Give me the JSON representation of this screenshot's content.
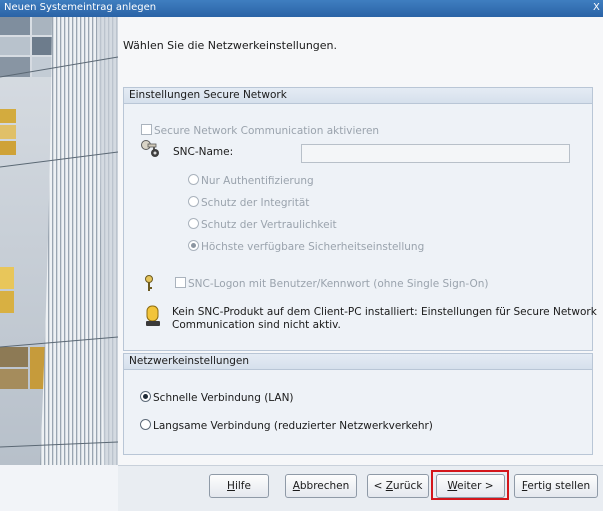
{
  "window": {
    "title": "Neuen Systemeintrag anlegen",
    "close_glyph": "X"
  },
  "intro_text": "Wählen Sie die Netzwerkeinstellungen.",
  "secure_network": {
    "heading": "Einstellungen Secure Network",
    "snc_activate_label": "Secure Network Communication aktivieren",
    "snc_name_label": "SNC-Name:",
    "snc_name_value": "",
    "protection_options": [
      "Nur Authentifizierung",
      "Schutz der Integrität",
      "Schutz der Vertraulichkeit",
      "Höchste verfügbare Sicherheitseinstellung"
    ],
    "snc_logon_label": "SNC-Logon mit Benutzer/Kennwort (ohne Single Sign-On)",
    "info_line1": "Kein SNC-Produkt auf dem Client-PC installiert: Einstellungen für Secure Network",
    "info_line2": "Communication sind nicht aktiv."
  },
  "network": {
    "heading": "Netzwerkeinstellungen",
    "option_fast": "Schnelle Verbindung (LAN)",
    "option_slow": "Langsame Verbindung (reduzierter Netzwerkverkehr)"
  },
  "buttons": {
    "help": {
      "key": "H",
      "rest": "ilfe"
    },
    "cancel": {
      "key": "A",
      "rest": "bbrechen"
    },
    "back": {
      "prefix": "< ",
      "key": "Z",
      "rest": "urück"
    },
    "next": {
      "key": "W",
      "rest": "eiter >"
    },
    "finish": {
      "key": "F",
      "rest": "ertig stellen"
    }
  },
  "colors": {
    "title_bar": "#2a63a6",
    "highlight": "#d4161b"
  }
}
